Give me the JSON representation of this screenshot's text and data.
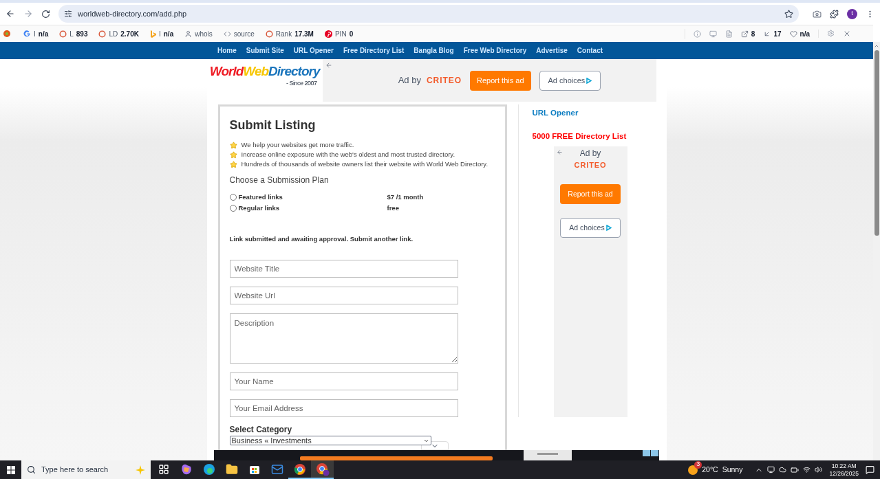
{
  "browser": {
    "url": "worldweb-directory.com/add.php",
    "profile": "t"
  },
  "extension_bar": {
    "items": [
      {
        "kind": "google",
        "prefix": "I",
        "value": "n/a"
      },
      {
        "kind": "circle",
        "prefix": "L",
        "value": "893"
      },
      {
        "kind": "circle",
        "prefix": "LD",
        "value": "2.70K"
      },
      {
        "kind": "bing",
        "prefix": "I",
        "value": "n/a"
      },
      {
        "kind": "user",
        "prefix": "whois",
        "value": ""
      },
      {
        "kind": "code",
        "prefix": "source",
        "value": ""
      },
      {
        "kind": "circle",
        "prefix": "Rank",
        "value": "17.3M"
      },
      {
        "kind": "pin",
        "prefix": "PIN",
        "value": "0"
      }
    ],
    "right_items": [
      {
        "kind": "external",
        "value": "8"
      },
      {
        "kind": "inbound",
        "value": "17"
      },
      {
        "kind": "heart",
        "value": "n/a"
      }
    ]
  },
  "nav": [
    "Home",
    "Submit Site",
    "URL Opener",
    "Free Directory List",
    "Bangla Blog",
    "Free Web Directory",
    "Advertise",
    "Contact"
  ],
  "logo": {
    "words": [
      {
        "text": "World",
        "color": "#ee1c25"
      },
      {
        "text": "Web",
        "color": "#f7c600"
      },
      {
        "text": "Directory",
        "color": "#1b75bc"
      }
    ],
    "tagline": "- Since 2007"
  },
  "top_ad": {
    "ad_by": "Ad by",
    "brand": "CRITEO",
    "report": "Report this ad",
    "choices": "Ad choices"
  },
  "form": {
    "title": "Submit Listing",
    "benefits": [
      "We help your websites get more traffic.",
      "Increase online exposure with the web's oldest and most trusted directory.",
      "Hundreds of thousands of website owners list their website with World Web Directory."
    ],
    "plan_heading": "Choose a Submission Plan",
    "plans": [
      {
        "label": "Featured links",
        "price": "$7 /1 month",
        "selected": false
      },
      {
        "label": "Regular links",
        "price": "free",
        "selected": false
      }
    ],
    "message": "Link submitted and awaiting approval. Submit another link.",
    "fields": [
      {
        "kind": "input",
        "placeholder": "Website Title"
      },
      {
        "kind": "input",
        "placeholder": "Website Url"
      },
      {
        "kind": "textarea",
        "placeholder": "Description"
      },
      {
        "kind": "input",
        "placeholder": "Your Name"
      },
      {
        "kind": "input",
        "placeholder": "Your Email Address"
      }
    ],
    "category_label": "Select Category",
    "category_value": "Business « Investments"
  },
  "sidebar": {
    "links": [
      {
        "label": "URL Opener",
        "color": "#0a7cc1"
      },
      {
        "label": "5000 FREE Directory List",
        "color": "#ff0000"
      }
    ],
    "ad": {
      "ad_by": "Ad by",
      "brand": "CRITEO",
      "report": "Report this ad",
      "choices": "Ad choices"
    }
  },
  "taskbar": {
    "search_placeholder": "Type here to search",
    "temperature": "20°C",
    "condition": "Sunny",
    "weather_badge": "3",
    "time": "10:22 AM",
    "date": "12/26/2025",
    "apps": [
      {
        "kind": "taskview",
        "active": false
      },
      {
        "kind": "copilot",
        "active": false
      },
      {
        "kind": "edge",
        "active": false
      },
      {
        "kind": "files",
        "active": false
      },
      {
        "kind": "store",
        "active": false
      },
      {
        "kind": "mail",
        "active": false
      },
      {
        "kind": "chrome",
        "active": true
      },
      {
        "kind": "chrome-profile",
        "active": true
      }
    ]
  }
}
